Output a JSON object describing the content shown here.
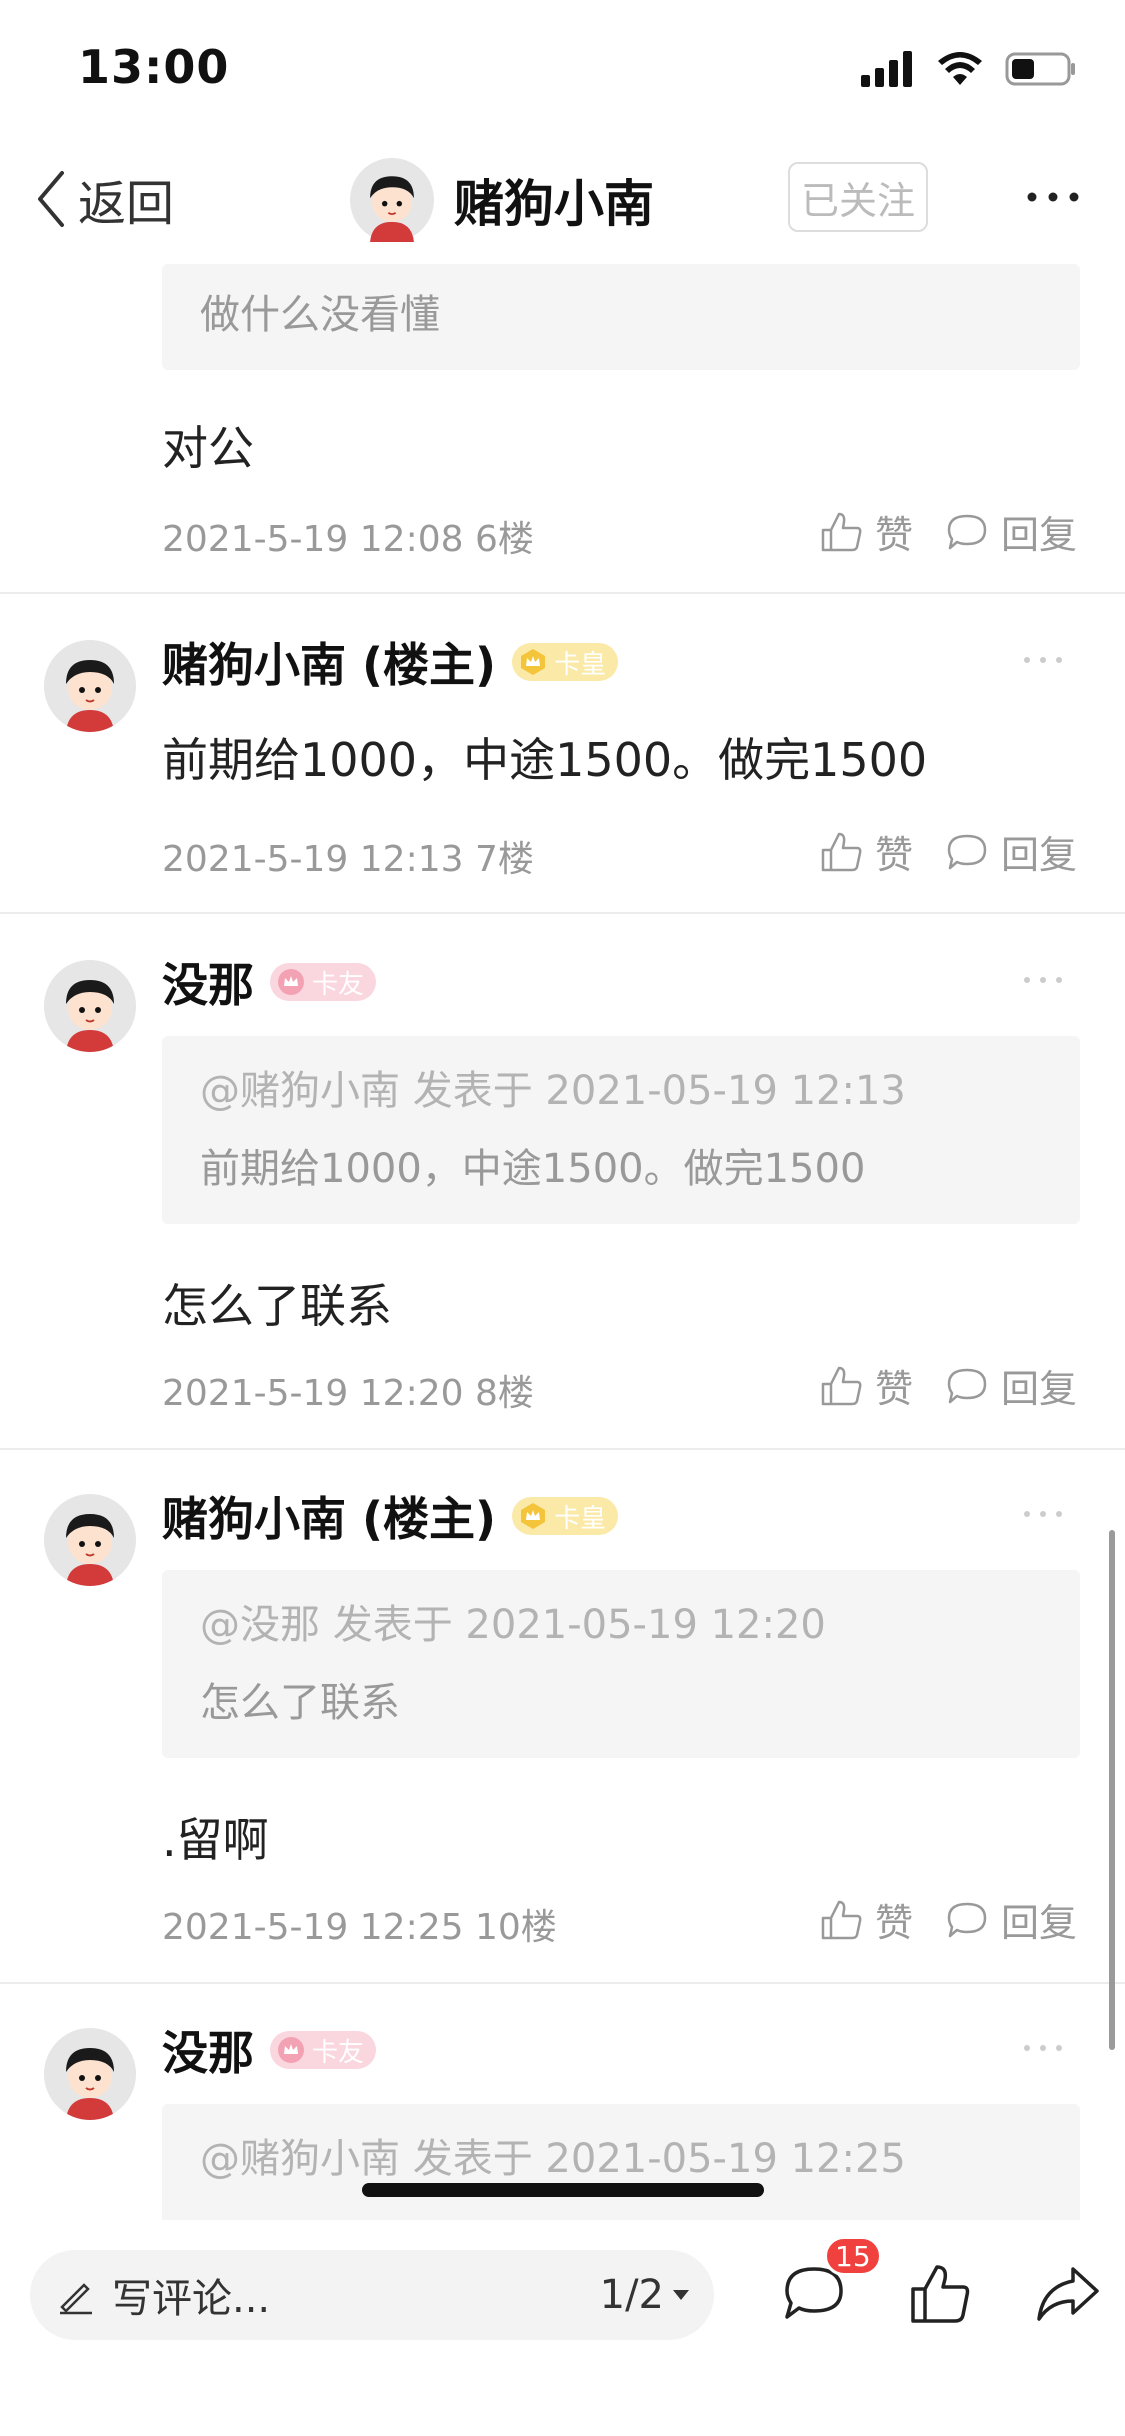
{
  "status_bar": {
    "time": "13:00"
  },
  "nav": {
    "back_label": "返回",
    "user_name": "赌狗小南",
    "follow_label": "已关注"
  },
  "thread": {
    "top_quote": "做什么没看懂",
    "top_reply": "对公",
    "top_meta": {
      "date": "2021-5-19 12:08",
      "floor": "6楼"
    },
    "posts": [
      {
        "name": "赌狗小南 (楼主)",
        "badge": "卡皇",
        "text": "前期给1000，中途1500。做完1500",
        "date": "2021-5-19 12:13",
        "floor": "7楼"
      },
      {
        "name": "没那",
        "badge": "卡友",
        "quote_header": "@赌狗小南 发表于 2021-05-19 12:13",
        "quote_body": "前期给1000，中途1500。做完1500",
        "text": "怎么了联系",
        "date": "2021-5-19 12:20",
        "floor": "8楼"
      },
      {
        "name": "赌狗小南 (楼主)",
        "badge": "卡皇",
        "quote_header": "@没那 发表于 2021-05-19 12:20",
        "quote_body": "怎么了联系",
        "text": ".留啊",
        "date": "2021-5-19 12:25",
        "floor": "10楼"
      },
      {
        "name": "没那",
        "badge": "卡友",
        "quote_header": "@赌狗小南 发表于 2021-05-19 12:25"
      }
    ],
    "like_label": "赞",
    "reply_label": "回复"
  },
  "bottom_bar": {
    "input_placeholder": "写评论...",
    "page": "1/2",
    "comment_count": "15"
  },
  "colors": {
    "badge_red": "#f0413e",
    "muted": "#999999",
    "gold_badge": "#fbe9a8",
    "pink_badge": "#fad6de"
  }
}
